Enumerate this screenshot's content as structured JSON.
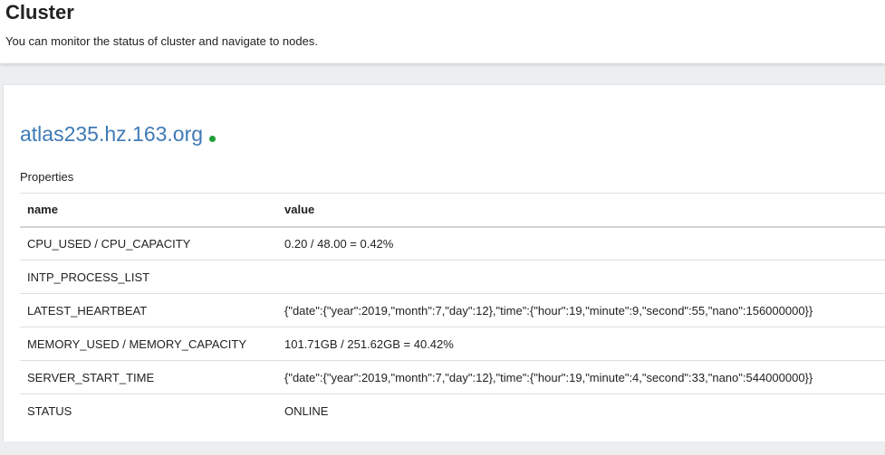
{
  "header": {
    "title": "Cluster",
    "subtitle": "You can monitor the status of cluster and navigate to nodes."
  },
  "node": {
    "host": "atlas235.hz.163.org",
    "status_color": "#1f9d37",
    "properties_label": "Properties",
    "columns": {
      "name": "name",
      "value": "value"
    },
    "rows": [
      {
        "name": "CPU_USED / CPU_CAPACITY",
        "value": "0.20 / 48.00 = 0.42%"
      },
      {
        "name": "INTP_PROCESS_LIST",
        "value": ""
      },
      {
        "name": "LATEST_HEARTBEAT",
        "value": "{\"date\":{\"year\":2019,\"month\":7,\"day\":12},\"time\":{\"hour\":19,\"minute\":9,\"second\":55,\"nano\":156000000}}"
      },
      {
        "name": "MEMORY_USED / MEMORY_CAPACITY",
        "value": "101.71GB / 251.62GB = 40.42%"
      },
      {
        "name": "SERVER_START_TIME",
        "value": "{\"date\":{\"year\":2019,\"month\":7,\"day\":12},\"time\":{\"hour\":19,\"minute\":4,\"second\":33,\"nano\":544000000}}"
      },
      {
        "name": "STATUS",
        "value": "ONLINE"
      }
    ]
  }
}
